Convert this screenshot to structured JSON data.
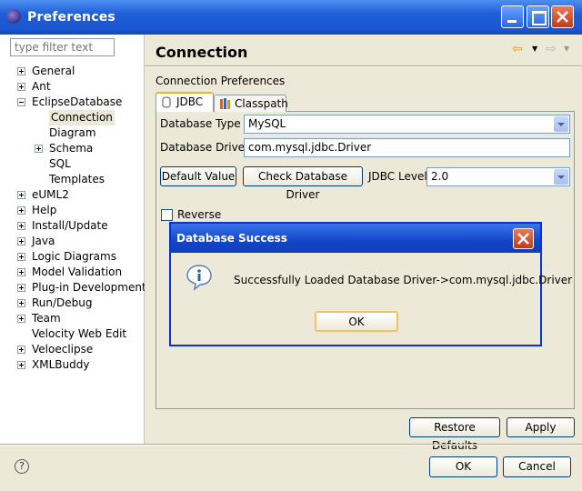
{
  "window": {
    "title": "Preferences"
  },
  "filter": {
    "placeholder": "type filter text"
  },
  "tree": [
    {
      "label": "General",
      "expander": "plus"
    },
    {
      "label": "Ant",
      "expander": "plus"
    },
    {
      "label": "EclipseDatabase",
      "expander": "minus"
    },
    {
      "label": "Connection",
      "expander": "",
      "selected": true
    },
    {
      "label": "Diagram",
      "expander": ""
    },
    {
      "label": "Schema",
      "expander": "plus"
    },
    {
      "label": "SQL",
      "expander": ""
    },
    {
      "label": "Templates",
      "expander": ""
    },
    {
      "label": "eUML2",
      "expander": "plus"
    },
    {
      "label": "Help",
      "expander": "plus"
    },
    {
      "label": "Install/Update",
      "expander": "plus"
    },
    {
      "label": "Java",
      "expander": "plus"
    },
    {
      "label": "Logic Diagrams",
      "expander": "plus"
    },
    {
      "label": "Model Validation",
      "expander": "plus"
    },
    {
      "label": "Plug-in Development",
      "expander": "plus"
    },
    {
      "label": "Run/Debug",
      "expander": "plus"
    },
    {
      "label": "Team",
      "expander": "plus"
    },
    {
      "label": "Velocity Web Edit",
      "expander": ""
    },
    {
      "label": "Veloeclipse",
      "expander": "plus"
    },
    {
      "label": "XMLBuddy",
      "expander": "plus"
    }
  ],
  "page": {
    "heading": "Connection",
    "subheading": "Connection Preferences",
    "tabs": {
      "jdbc": "JDBC",
      "classpath": "Classpath"
    },
    "db_type_label": "Database Type",
    "db_type_value": "MySQL",
    "db_driver_label": "Database Driver",
    "db_driver_value": "com.mysql.jdbc.Driver",
    "default_value_btn": "Default Value",
    "check_driver_btn": "Check Database Driver",
    "jdbc_level_label": "JDBC Level",
    "jdbc_level_value": "2.0",
    "reverse_label": "Reverse",
    "restore_defaults_btn": "Restore Defaults",
    "apply_btn": "Apply"
  },
  "dialog": {
    "title": "Database Success",
    "message": "Successfully Loaded Database Driver->com.mysql.jdbc.Driver",
    "ok": "OK"
  },
  "footer": {
    "ok": "OK",
    "cancel": "Cancel"
  },
  "colors": {
    "title_bar": "#1f5ed8",
    "dialog_border": "#0831d9",
    "close_red": "#c3391d",
    "tab_accent": "#f0b030"
  }
}
